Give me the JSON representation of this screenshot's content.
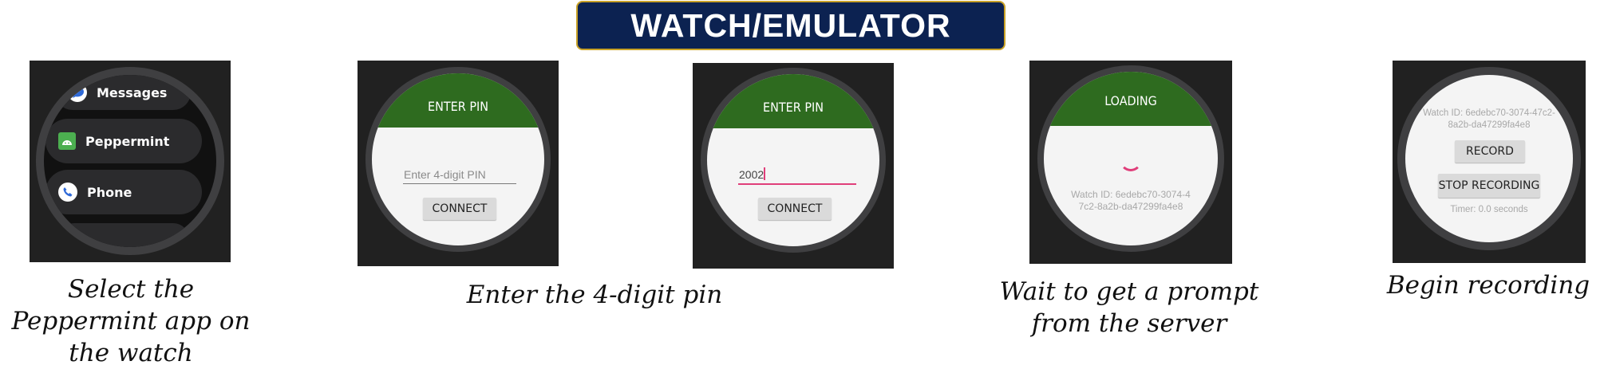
{
  "header": {
    "title": "WATCH/EMULATOR"
  },
  "step1": {
    "apps": [
      {
        "label": "Messages",
        "icon": "messages-icon"
      },
      {
        "label": "Peppermint",
        "icon": "android-icon"
      },
      {
        "label": "Phone",
        "icon": "phone-icon"
      }
    ],
    "caption": [
      "Select the",
      "Peppermint app on",
      "the watch"
    ]
  },
  "step2a": {
    "header": "ENTER PIN",
    "pin_placeholder": "Enter 4-digit PIN",
    "connect_label": "CONNECT"
  },
  "step2b": {
    "header": "ENTER PIN",
    "pin_value": "2002",
    "connect_label": "CONNECT"
  },
  "step2_caption": "Enter the 4-digit pin",
  "step3": {
    "header": "LOADING",
    "watch_id": [
      "Watch ID: 6edebc70-3074-4",
      "7c2-8a2b-da47299fa4e8"
    ],
    "caption": [
      "Wait to get a prompt",
      "from the server"
    ]
  },
  "step4": {
    "watch_id": [
      "Watch ID: 6edebc70-3074-47c2-",
      "8a2b-da47299fa4e8"
    ],
    "record_label": "RECORD",
    "stop_label": "STOP RECORDING",
    "timer": "Timer: 0.0 seconds",
    "caption": "Begin recording"
  },
  "colors": {
    "banner_bg": "#0c2251",
    "banner_border": "#c9a227",
    "header_green": "#2e6b1f",
    "spinner": "#e03e7a",
    "pin_underline_active": "#e03e7a"
  }
}
